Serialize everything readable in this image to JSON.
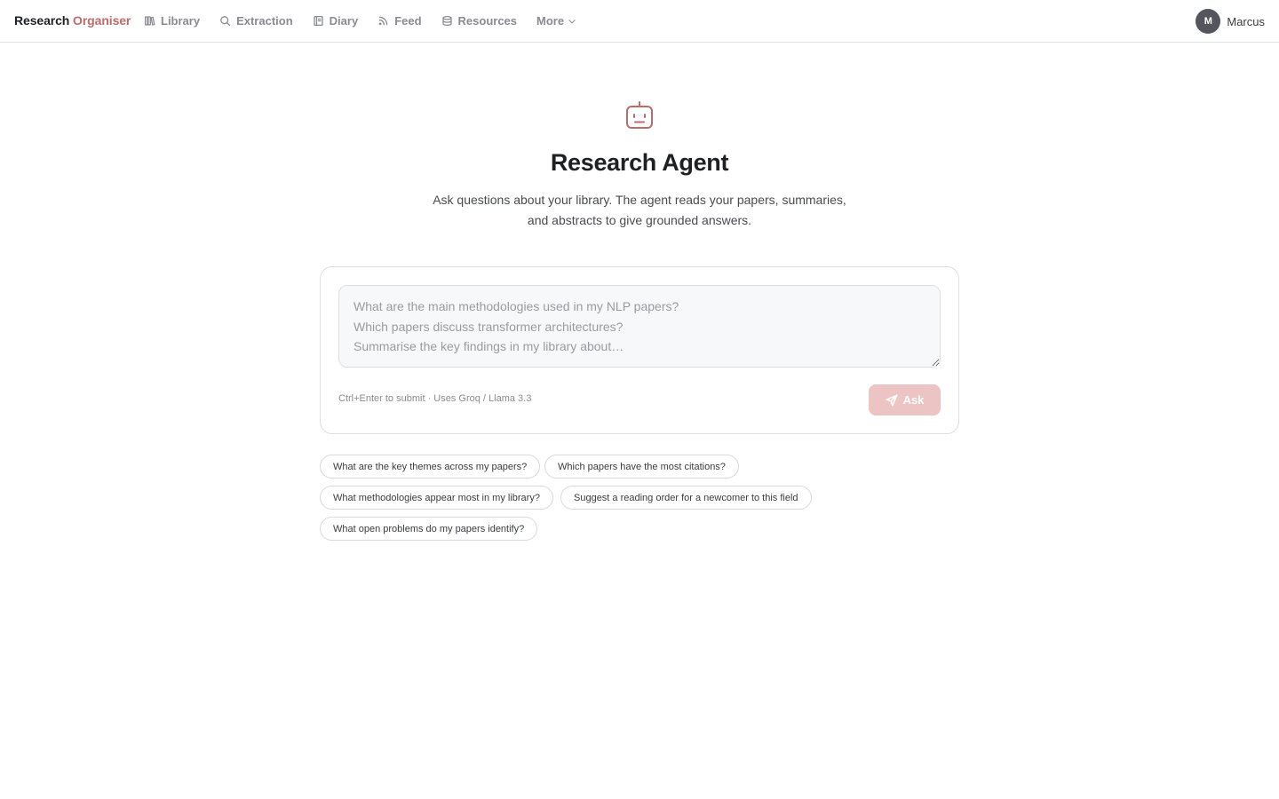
{
  "brand": {
    "part1": "Research",
    "part2": "Organiser"
  },
  "nav": {
    "items": [
      {
        "label": "Library",
        "icon": "books-icon"
      },
      {
        "label": "Extraction",
        "icon": "search-icon"
      },
      {
        "label": "Diary",
        "icon": "notebook-icon"
      },
      {
        "label": "Feed",
        "icon": "rss-icon"
      },
      {
        "label": "Resources",
        "icon": "layers-icon"
      }
    ],
    "more_label": "More"
  },
  "user": {
    "initial": "M",
    "name": "Marcus"
  },
  "hero": {
    "icon": "robot-icon",
    "title": "Research Agent",
    "subtitle_line1": "Ask questions about your library. The agent reads your papers, summaries,",
    "subtitle_line2": "and abstracts to give grounded answers."
  },
  "ask": {
    "placeholder": "What are the main methodologies used in my NLP papers?\nWhich papers discuss transformer architectures?\nSummarise the key findings in my library about…",
    "value": "",
    "hint": "Ctrl+Enter to submit · Uses Groq / Llama 3.3",
    "button_label": "Ask",
    "button_icon": "send-icon"
  },
  "suggestions": [
    "What are the key themes across my papers?",
    "Which papers have the most citations?",
    "What methodologies appear most in my library?",
    "Suggest a reading order for a newcomer to this field",
    "What open problems do my papers identify?"
  ],
  "colors": {
    "accent": "#c06a6a",
    "button_disabled": "#ecc4c4",
    "avatar": "#55565b"
  }
}
